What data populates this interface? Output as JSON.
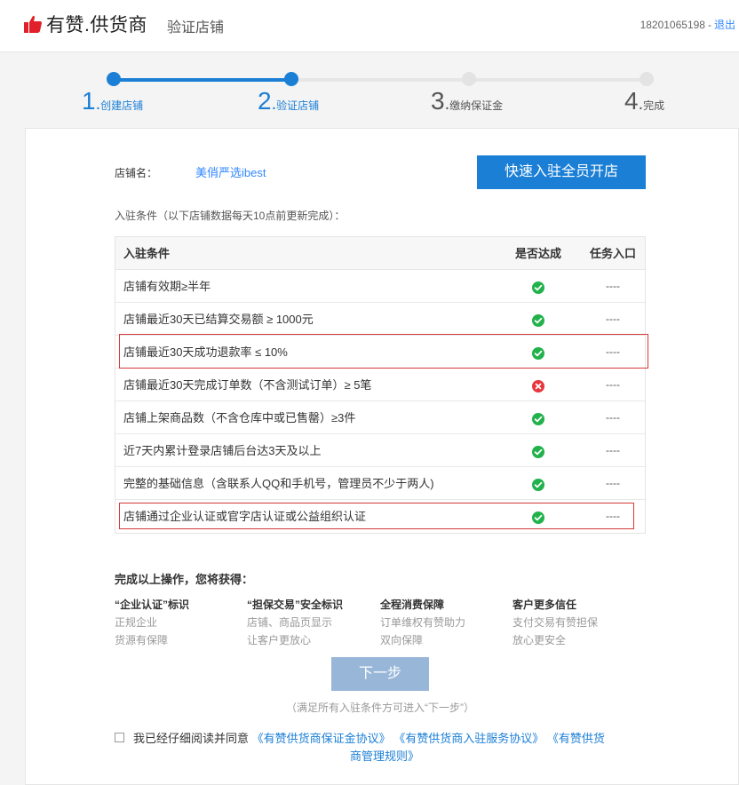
{
  "header": {
    "brand": "有赞.供货商",
    "page_title": "验证店铺",
    "phone": "18201065198",
    "separator": "-",
    "logout": "退出"
  },
  "steps": [
    {
      "num": "1",
      "label": "创建店铺",
      "state": "done"
    },
    {
      "num": "2",
      "label": "验证店铺",
      "state": "done"
    },
    {
      "num": "3",
      "label": "缴纳保证金",
      "state": "todo"
    },
    {
      "num": "4",
      "label": "完成",
      "state": "todo"
    }
  ],
  "shop": {
    "label": "店铺名：",
    "name": "美俏严选ibest",
    "fast_button": "快速入驻全员开店",
    "note": "入驻条件（以下店铺数据每天10点前更新完成）："
  },
  "table": {
    "headers": [
      "入驻条件",
      "是否达成",
      "任务入口"
    ],
    "rows": [
      {
        "condition": "店铺有效期≥半年",
        "status": "ok",
        "entry": "----"
      },
      {
        "condition": "店铺最近30天已结算交易额 ≥ 1000元",
        "status": "ok",
        "entry": "----"
      },
      {
        "condition": "店铺最近30天成功退款率 ≤ 10%",
        "status": "ok",
        "entry": "----"
      },
      {
        "condition": "店铺最近30天完成订单数（不含测试订单）≥ 5笔",
        "status": "fail",
        "entry": "----"
      },
      {
        "condition": "店铺上架商品数（不含仓库中或已售罄）≥3件",
        "status": "ok",
        "entry": "----"
      },
      {
        "condition": "近7天内累计登录店铺后台达3天及以上",
        "status": "ok",
        "entry": "----"
      },
      {
        "condition": "完整的基础信息（含联系人QQ和手机号，管理员不少于两人)",
        "status": "ok",
        "entry": "----"
      },
      {
        "condition": "店铺通过企业认证或官字店认证或公益组织认证",
        "status": "ok",
        "entry": "----"
      }
    ]
  },
  "benefits": {
    "title": "完成以上操作，您将获得：",
    "columns": [
      {
        "heading": "“企业认证”标识",
        "lines": [
          "正规企业",
          "货源有保障"
        ]
      },
      {
        "heading": "“担保交易”安全标识",
        "lines": [
          "店铺、商品页显示",
          "让客户更放心"
        ]
      },
      {
        "heading": "全程消费保障",
        "lines": [
          "订单维权有赞助力",
          "双向保障"
        ]
      },
      {
        "heading": "客户更多信任",
        "lines": [
          "支付交易有赞担保",
          "放心更安全"
        ]
      }
    ]
  },
  "next": {
    "button": "下一步",
    "hint": "（满足所有入驻条件方可进入“下一步”）"
  },
  "agreement": {
    "prefix": "我已经仔细阅读并同意",
    "link1": "《有赞供货商保证金协议》",
    "link2": "《有赞供货商入驻服务协议》",
    "link3_part1": "《有赞供货",
    "link3_part2": "商管理规则》"
  },
  "colors": {
    "primary": "#1b7fd6",
    "ok": "#22b24c",
    "fail": "#e8363e",
    "highlight": "#d53a3a",
    "disabled_button": "#98b7d8"
  },
  "icons": {
    "logo": "thumbs-up-icon",
    "ok": "check-circle-icon",
    "fail": "x-circle-icon"
  }
}
